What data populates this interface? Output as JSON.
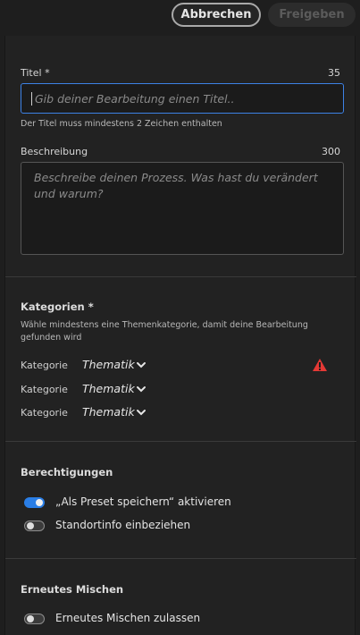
{
  "topbar": {
    "cancel_label": "Abbrechen",
    "share_label": "Freigeben"
  },
  "details": {
    "title_label": "Titel *",
    "title_counter": "35",
    "title_placeholder": "Gib deiner Bearbeitung einen Titel..",
    "title_hint": "Der Titel muss mindestens 2 Zeichen enthalten",
    "description_label": "Beschreibung",
    "description_counter": "300",
    "description_placeholder": "Beschreibe deinen Prozess. Was hast du verändert und warum?"
  },
  "categories": {
    "heading": "Kategorien *",
    "subtitle": "Wähle mindestens eine Themenkategorie, damit deine Bearbeitung gefunden wird",
    "rows": [
      {
        "label": "Kategorie",
        "value": "Thematik",
        "warning": true
      },
      {
        "label": "Kategorie",
        "value": "Thematik",
        "warning": false
      },
      {
        "label": "Kategorie",
        "value": "Thematik",
        "warning": false
      }
    ]
  },
  "permissions": {
    "heading": "Berechtigungen",
    "toggles": [
      {
        "label": "„Als Preset speichern“ aktivieren",
        "on": true
      },
      {
        "label": "Standortinfo einbeziehen",
        "on": false
      }
    ]
  },
  "remix": {
    "heading": "Erneutes Mischen",
    "toggles": [
      {
        "label": "Erneutes Mischen zulassen",
        "on": false
      }
    ]
  },
  "colors": {
    "accent": "#2a7ee6",
    "warning": "#e53935",
    "focus_border": "#3d82e6"
  },
  "icons": {
    "chevron": "chevron-down-icon",
    "warning": "warning-icon"
  }
}
